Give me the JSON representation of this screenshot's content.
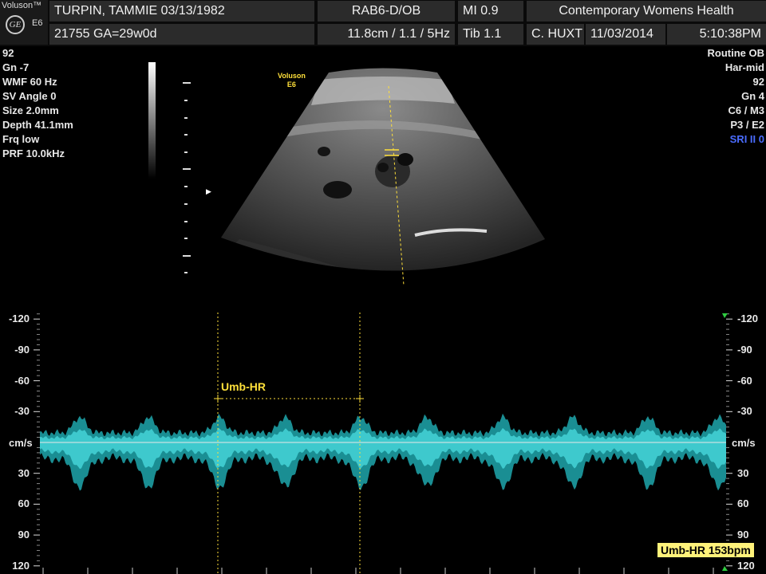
{
  "header": {
    "brand": "Voluson™",
    "model": "E6",
    "ge_logo": "GE",
    "patient": "TURPIN, TAMMIE  03/13/1982",
    "id_ga": "21755  GA=29w0d",
    "probe": "RAB6-D/OB",
    "depth_freq": "11.8cm / 1.1 / 5Hz",
    "mi": "MI  0.9",
    "tib": "Tib  1.1",
    "clinic": "Contemporary Womens Health",
    "operator": "C. HUXT",
    "date": "11/03/2014",
    "time": "5:10:38PM"
  },
  "left_params": [
    "92",
    "Gn  -7",
    "WMF 60 Hz",
    "SV Angle  0",
    "Size  2.0mm",
    "Depth 41.1mm",
    "Frq low",
    "PRF 10.0kHz"
  ],
  "right_params": [
    "Routine OB",
    "Har-mid",
    "92",
    "Gn   4",
    "C6 / M3",
    "P3 / E2"
  ],
  "right_sri": "SRI II 0",
  "image_badge": {
    "line1": "Voluson",
    "line2": "E6"
  },
  "doppler": {
    "unit_label": "cm/s",
    "scale_labels": [
      "-120",
      "-90",
      "-60",
      "-30",
      "30",
      "60",
      "90",
      "120"
    ],
    "scale_values": [
      -120,
      -90,
      -60,
      -30,
      30,
      60,
      90,
      120
    ],
    "caliper_label": "Umb-HR",
    "heart_rate_result": "Umb-HR 153bpm"
  },
  "colors": {
    "trace": "#2fc9cf",
    "caliper": "#ffe03a",
    "header_cell": "#2b2b2b"
  }
}
